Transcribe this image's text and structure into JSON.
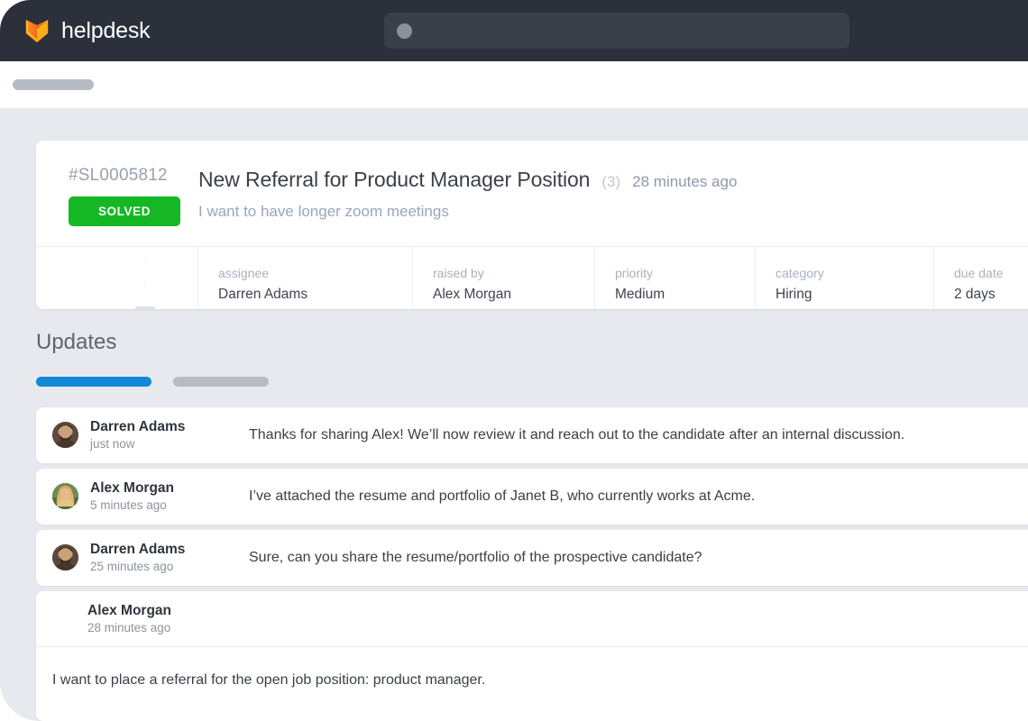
{
  "app": {
    "brand_name": "helpdesk",
    "logo_icon": "fox-shield-logo",
    "accent_blue": "#1288d8",
    "status_green": "#15b824",
    "header_bg": "#2b303b",
    "page_bg": "#e7e9ee"
  },
  "search": {
    "value": "",
    "placeholder": "",
    "icon": "search-placeholder-dot"
  },
  "ticket": {
    "id": "#SL0005812",
    "status": "SOLVED",
    "title": "New Referral for Product Manager Position",
    "count": "(3)",
    "time": "28 minutes ago",
    "subtitle": "I want to have longer zoom meetings",
    "actions": [
      {
        "name": "pin-icon"
      },
      {
        "name": "star-icon"
      },
      {
        "name": "placeholder-square-icon"
      }
    ],
    "meta": [
      {
        "label": "assignee",
        "value": "Darren Adams"
      },
      {
        "label": "raised by",
        "value": "Alex Morgan"
      },
      {
        "label": "priority",
        "value": "Medium"
      },
      {
        "label": "category",
        "value": "Hiring"
      },
      {
        "label": "due date",
        "value": "2 days"
      }
    ]
  },
  "updates": {
    "heading": "Updates",
    "tabs": [
      {
        "label": "",
        "active": true
      },
      {
        "label": "",
        "active": false
      }
    ],
    "messages": [
      {
        "author": "Darren Adams",
        "time": "just now",
        "text": "Thanks for sharing Alex! We’ll now review it and reach out to the candidate after an internal discussion.",
        "avatar": "avatar-darren-adams"
      },
      {
        "author": "Alex Morgan",
        "time": "5 minutes ago",
        "text": "I’ve attached the resume and portfolio of Janet B, who currently works at Acme.",
        "avatar": "avatar-alex-morgan"
      },
      {
        "author": "Darren Adams",
        "time": "25 minutes ago",
        "text": "Sure, can you share the resume/portfolio of the prospective candidate?",
        "avatar": "avatar-darren-adams"
      }
    ],
    "expanded_message": {
      "author": "Alex Morgan",
      "time": "28 minutes ago",
      "text": "I want to place a referral for the open job position: product manager."
    }
  }
}
